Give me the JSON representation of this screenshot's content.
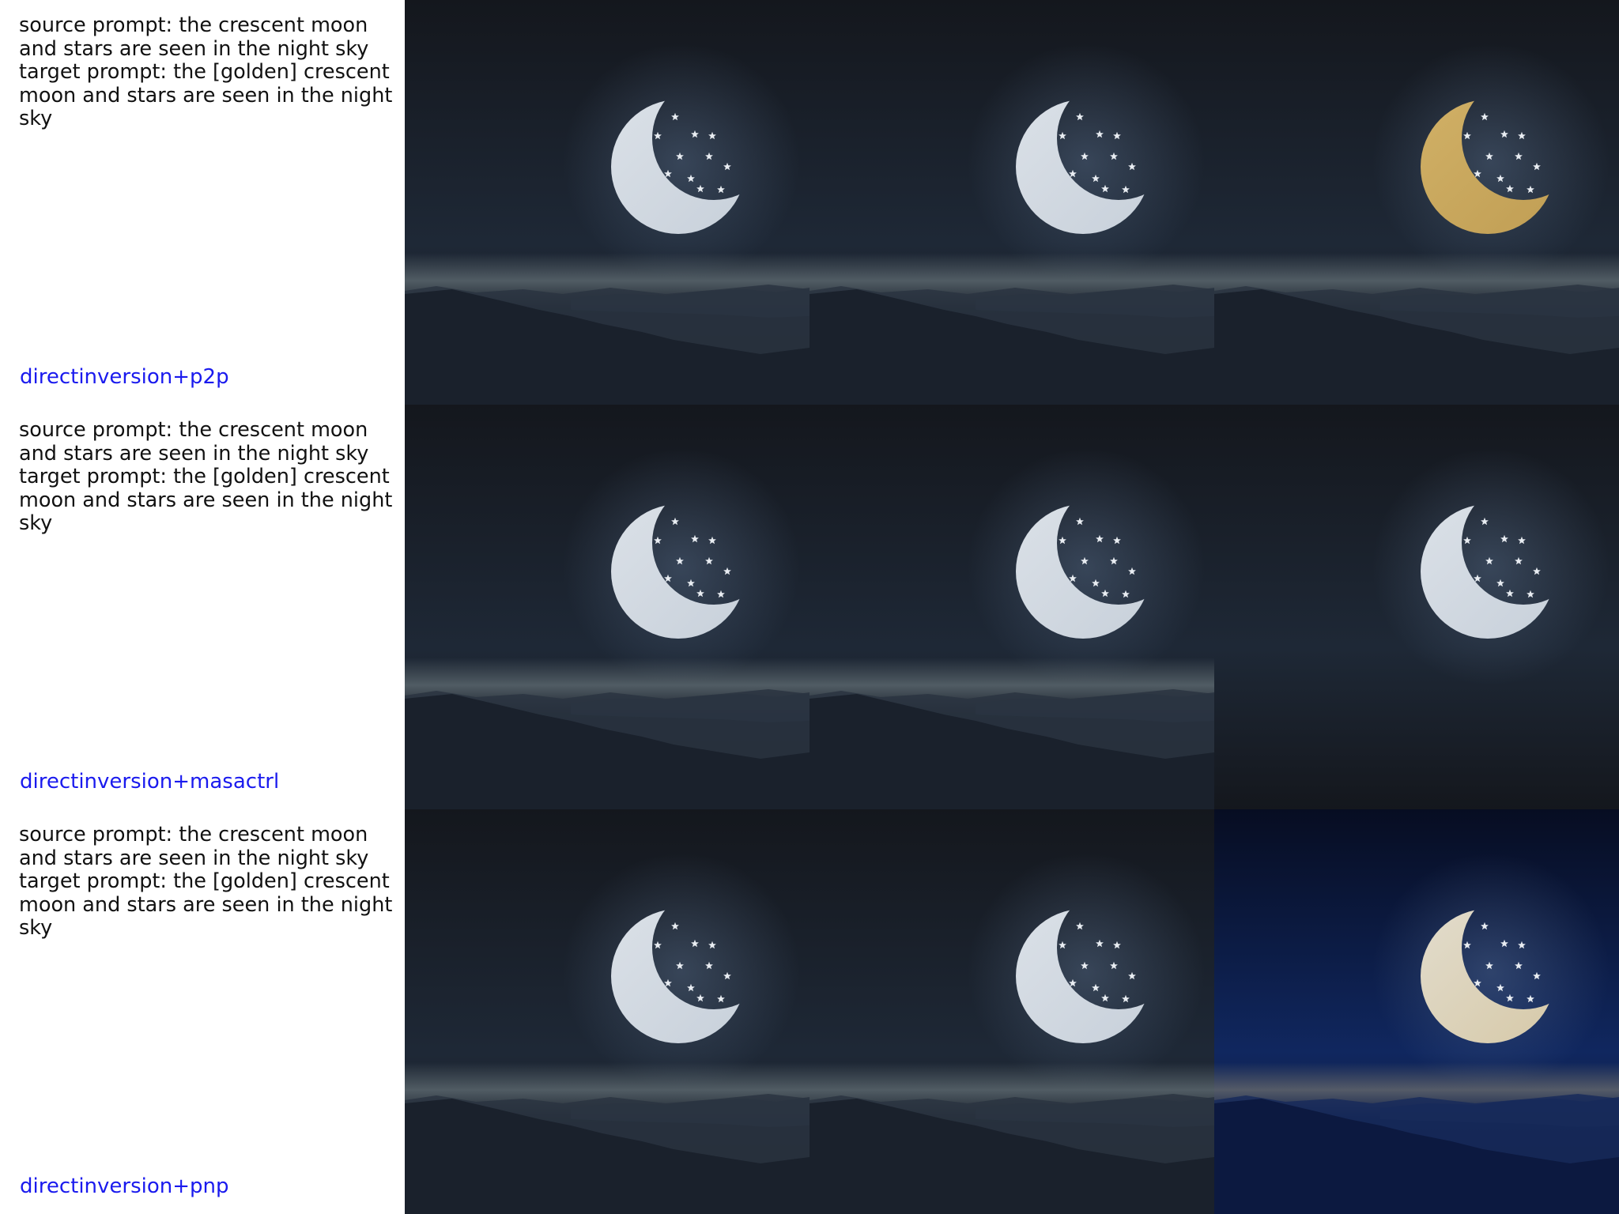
{
  "rows": [
    {
      "prompt_lines": [
        "source prompt: the crescent moon",
        "and stars are seen in the night sky",
        "target prompt: the [golden] crescent",
        "moon and stars are seen in the night",
        "sky"
      ],
      "method": "directinversion+p2p",
      "images": [
        {
          "name": "source-image",
          "moon": "silver",
          "sky": "dark",
          "mountains": true
        },
        {
          "name": "reconstruction-image",
          "moon": "silver",
          "sky": "dark",
          "mountains": true
        },
        {
          "name": "edited-image",
          "moon": "golden",
          "sky": "dark",
          "mountains": true
        }
      ]
    },
    {
      "prompt_lines": [
        "source prompt: the crescent moon",
        "and stars are seen in the night sky",
        "target prompt: the [golden] crescent",
        "moon and stars are seen in the night",
        "sky"
      ],
      "method": "directinversion+masactrl",
      "images": [
        {
          "name": "source-image",
          "moon": "silver",
          "sky": "dark",
          "mountains": true
        },
        {
          "name": "reconstruction-image",
          "moon": "silver",
          "sky": "dark",
          "mountains": true
        },
        {
          "name": "edited-image",
          "moon": "silver",
          "sky": "dark",
          "mountains": false
        }
      ]
    },
    {
      "prompt_lines": [
        "source prompt: the crescent moon",
        "and stars are seen in the night sky",
        "target prompt: the [golden] crescent",
        "moon and stars are seen in the night",
        "sky"
      ],
      "method": "directinversion+pnp",
      "images": [
        {
          "name": "source-image",
          "moon": "silver",
          "sky": "dark",
          "mountains": true
        },
        {
          "name": "reconstruction-image",
          "moon": "silver",
          "sky": "dark",
          "mountains": true
        },
        {
          "name": "edited-image",
          "moon": "silver-gold-edge",
          "sky": "blue",
          "mountains": true
        }
      ]
    }
  ],
  "colors": {
    "page_background": "#ffffff",
    "prompt_text": "#111111",
    "method_text": "#1a1aee",
    "moon_silver": "#dfe5ec",
    "moon_golden": "#d2b064",
    "sky_dark": "#161a21",
    "sky_blue": "#0b1a45"
  }
}
